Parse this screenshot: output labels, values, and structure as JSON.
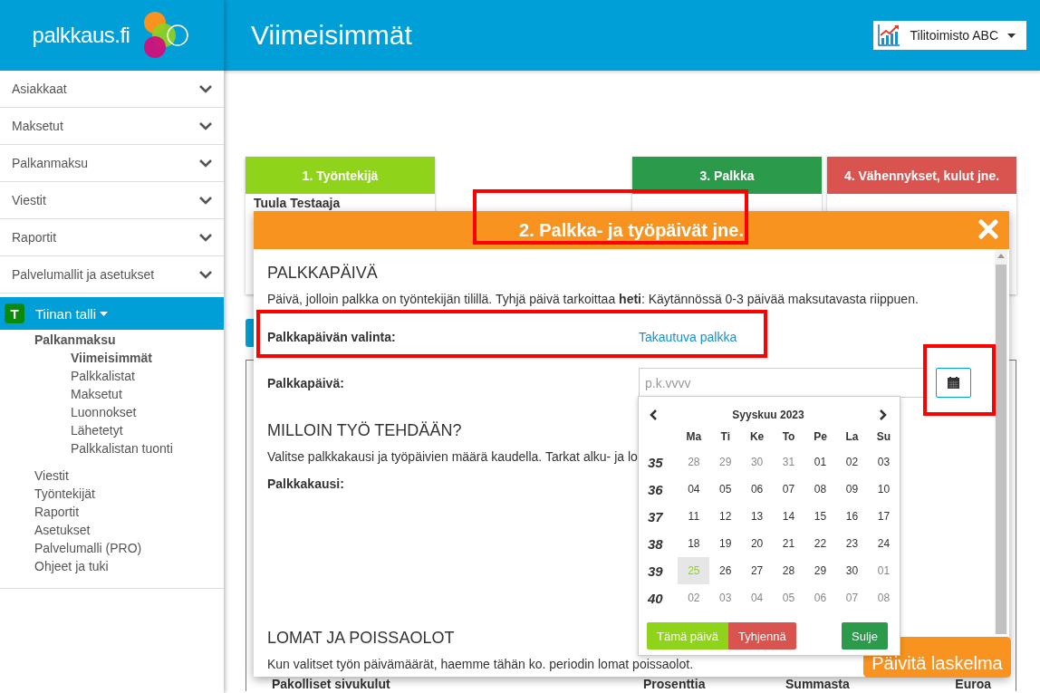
{
  "sidebar": {
    "logo": "palkkaus.fi",
    "items": [
      {
        "label": "Asiakkaat"
      },
      {
        "label": "Maksetut"
      },
      {
        "label": "Palkanmaksu"
      },
      {
        "label": "Viestit"
      },
      {
        "label": "Raportit"
      },
      {
        "label": "Palvelumallit ja asetukset"
      }
    ],
    "company": {
      "avatar": "T",
      "name": "Tiinan talli",
      "selected": true,
      "sections": [
        {
          "label": "Palkanmaksu",
          "children": [
            {
              "label": "Viimeisimmät",
              "selected": true
            },
            {
              "label": "Palkkalistat",
              "selected": false
            },
            {
              "label": "Maksetut",
              "selected": false
            },
            {
              "label": "Luonnokset",
              "selected": false
            },
            {
              "label": "Lähetetyt",
              "selected": false
            },
            {
              "label": "Palkkalistan tuonti",
              "selected": false
            }
          ]
        }
      ],
      "links": [
        {
          "label": "Viestit"
        },
        {
          "label": "Työntekijät"
        },
        {
          "label": "Raportit"
        },
        {
          "label": "Asetukset"
        },
        {
          "label": "Palvelumalli (PRO)"
        },
        {
          "label": "Ohjeet ja tuki"
        }
      ]
    }
  },
  "header": {
    "title": "Viimeisimmät",
    "account": "Tilitoimisto ABC"
  },
  "steps": [
    {
      "label": "1. Työntekijä",
      "color": "#8fd31a",
      "content": "Tuula Testaaja"
    },
    {
      "label": "3. Palkka",
      "color": "#2b9a4b"
    },
    {
      "label": "4. Vähennykset, kulut jne.",
      "color": "#d9534f"
    }
  ],
  "table_header": [
    "Pakolliset sivukulut",
    "Prosenttia",
    "Summasta",
    "Euroa"
  ],
  "modal": {
    "title": "2. Palkka- ja työpäivät jne.",
    "sections": [
      {
        "heading": "PALKKAPÄIVÄ",
        "text": "Päivä, jolloin palkka on työntekijän tilillä. Tyhjä päivä tarkoittaa **heti**: Käytännössä 0-3 päivää maksutavasta riippuen.",
        "fields": [
          {
            "label": "Palkkapäivän valinta:",
            "kind": "link",
            "value": "Takautuva palkka"
          },
          {
            "label": "Palkkapäivä:",
            "kind": "date",
            "placeholder": "p.k.vvvv"
          }
        ]
      },
      {
        "heading": "MILLOIN TYÖ TEHDÄÄN?",
        "text": "Valitse palkkakausi ja työpäivien määrä kaudella. Tarkat alku- ja lo",
        "fields": [
          {
            "label": "Palkkakausi:",
            "kind": "blank"
          }
        ]
      },
      {
        "heading": "LOMAT JA POISSAOLOT",
        "text": "Kun valitset työn päivämäärät, haemme tähän ko. periodin lomat poissaolot."
      }
    ]
  },
  "datepicker": {
    "month": "Syyskuu 2023",
    "weekdays": [
      "Ma",
      "Ti",
      "Ke",
      "To",
      "Pe",
      "La",
      "Su"
    ],
    "weeks": [
      {
        "week": "35",
        "days": [
          {
            "d": "28",
            "other_month": true,
            "today": false
          },
          {
            "d": "29",
            "other_month": true,
            "today": false
          },
          {
            "d": "30",
            "other_month": true,
            "today": false
          },
          {
            "d": "31",
            "other_month": true,
            "today": false
          },
          {
            "d": "01",
            "other_month": false,
            "today": false
          },
          {
            "d": "02",
            "other_month": false,
            "today": false
          },
          {
            "d": "03",
            "other_month": false,
            "today": false
          }
        ]
      },
      {
        "week": "36",
        "days": [
          {
            "d": "04",
            "other_month": false,
            "today": false
          },
          {
            "d": "05",
            "other_month": false,
            "today": false
          },
          {
            "d": "06",
            "other_month": false,
            "today": false
          },
          {
            "d": "07",
            "other_month": false,
            "today": false
          },
          {
            "d": "08",
            "other_month": false,
            "today": false
          },
          {
            "d": "09",
            "other_month": false,
            "today": false
          },
          {
            "d": "10",
            "other_month": false,
            "today": false
          }
        ]
      },
      {
        "week": "37",
        "days": [
          {
            "d": "11",
            "other_month": false,
            "today": false
          },
          {
            "d": "12",
            "other_month": false,
            "today": false
          },
          {
            "d": "13",
            "other_month": false,
            "today": false
          },
          {
            "d": "14",
            "other_month": false,
            "today": false
          },
          {
            "d": "15",
            "other_month": false,
            "today": false
          },
          {
            "d": "16",
            "other_month": false,
            "today": false
          },
          {
            "d": "17",
            "other_month": false,
            "today": false
          }
        ]
      },
      {
        "week": "38",
        "days": [
          {
            "d": "18",
            "other_month": false,
            "today": false
          },
          {
            "d": "19",
            "other_month": false,
            "today": false
          },
          {
            "d": "20",
            "other_month": false,
            "today": false
          },
          {
            "d": "21",
            "other_month": false,
            "today": false
          },
          {
            "d": "22",
            "other_month": false,
            "today": false
          },
          {
            "d": "23",
            "other_month": false,
            "today": false
          },
          {
            "d": "24",
            "other_month": false,
            "today": false
          }
        ]
      },
      {
        "week": "39",
        "days": [
          {
            "d": "25",
            "other_month": false,
            "today": true
          },
          {
            "d": "26",
            "other_month": false,
            "today": false
          },
          {
            "d": "27",
            "other_month": false,
            "today": false
          },
          {
            "d": "28",
            "other_month": false,
            "today": false
          },
          {
            "d": "29",
            "other_month": false,
            "today": false
          },
          {
            "d": "30",
            "other_month": false,
            "today": false
          },
          {
            "d": "01",
            "other_month": true,
            "today": false
          }
        ]
      },
      {
        "week": "40",
        "days": [
          {
            "d": "02",
            "other_month": true,
            "today": false
          },
          {
            "d": "03",
            "other_month": true,
            "today": false
          },
          {
            "d": "04",
            "other_month": true,
            "today": false
          },
          {
            "d": "05",
            "other_month": true,
            "today": false
          },
          {
            "d": "06",
            "other_month": true,
            "today": false
          },
          {
            "d": "07",
            "other_month": true,
            "today": false
          },
          {
            "d": "08",
            "other_month": true,
            "today": false
          }
        ]
      }
    ],
    "buttons": [
      {
        "label": "Tämä päivä",
        "kind": "today"
      },
      {
        "label": "Tyhjennä",
        "kind": "clear"
      },
      {
        "label": "Sulje",
        "kind": "close"
      }
    ]
  },
  "update_button": "Päivitä laskelma"
}
